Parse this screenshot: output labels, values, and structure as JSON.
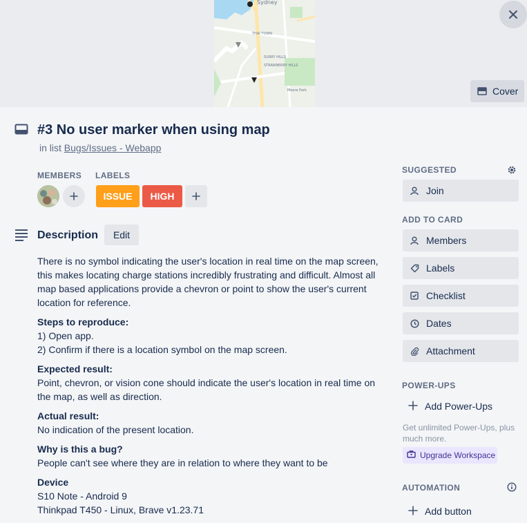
{
  "card": {
    "title": "#3 No user marker when using map",
    "in_list_prefix": "in list",
    "list_name": "Bugs/Issues - Webapp"
  },
  "cover": {
    "cover_button_label": "Cover",
    "map_labels": [
      "Sydney",
      "THAI TOWN",
      "SURRY HILLS",
      "STRAWBERRY HILLS",
      "Moore Park"
    ]
  },
  "members": {
    "heading": "Members"
  },
  "labels": {
    "heading": "Labels",
    "items": [
      {
        "text": "ISSUE",
        "color": "#ff9f1a"
      },
      {
        "text": "HIGH",
        "color": "#eb5a46"
      }
    ]
  },
  "description": {
    "heading": "Description",
    "edit_label": "Edit",
    "intro": "There is no symbol indicating the user's location in real time on the map screen, this makes locating charge stations incredibly frustrating and difficult. Almost all map based applications provide a chevron or point to show the user's current location for reference.",
    "steps_heading": "Steps to reproduce:",
    "step_1": "1) Open app.",
    "step_2": "2) Confirm if there is a location symbol on the map screen.",
    "expected_heading": "Expected result:",
    "expected_text": "Point, chevron, or vision cone should indicate the user's location in real time on the map, as well as direction.",
    "actual_heading": "Actual result:",
    "actual_text": "No indication of the present location.",
    "why_heading": "Why is this a bug?",
    "why_text": "People can't see where they are in relation to where they want to be",
    "device_heading": "Device",
    "device_1": "S10 Note - Android 9",
    "device_2": "Thinkpad T450 - Linux, Brave v1.23.71"
  },
  "sidebar": {
    "suggested_heading": "Suggested",
    "join_label": "Join",
    "add_to_card_heading": "Add to card",
    "add_to_card_items": [
      {
        "label": "Members",
        "icon": "person-icon"
      },
      {
        "label": "Labels",
        "icon": "tag-icon"
      },
      {
        "label": "Checklist",
        "icon": "checkbox-icon"
      },
      {
        "label": "Dates",
        "icon": "clock-icon"
      },
      {
        "label": "Attachment",
        "icon": "paperclip-icon"
      }
    ],
    "power_ups_heading": "Power-Ups",
    "add_power_ups_label": "Add Power-Ups",
    "power_ups_note": "Get unlimited Power-Ups, plus much more.",
    "upgrade_label": "Upgrade Workspace",
    "automation_heading": "Automation",
    "add_button_label": "Add button"
  },
  "colors": {
    "label_issue": "#ff9f1a",
    "label_high": "#eb5a46",
    "upgrade_bg": "#eae6ff",
    "upgrade_text": "#403294"
  }
}
